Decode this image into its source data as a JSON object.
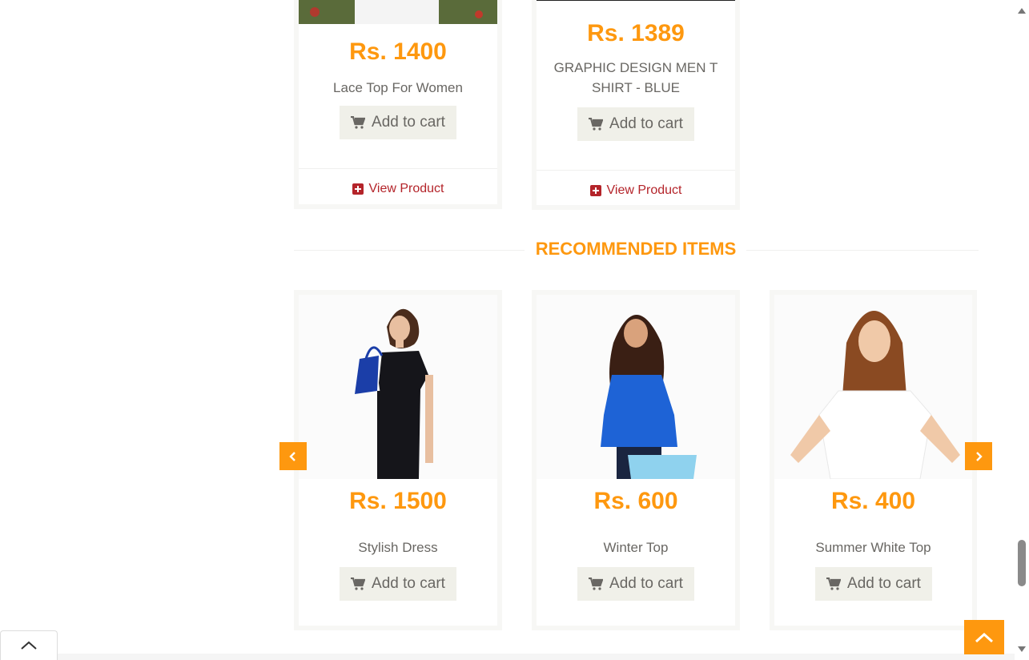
{
  "top_products": [
    {
      "price": "Rs. 1400",
      "name": "Lace Top For Women",
      "add_label": "Add to cart",
      "view_label": "View Product"
    },
    {
      "price": "Rs. 1389",
      "name": "GRAPHIC DESIGN MEN T SHIRT - BLUE",
      "add_label": "Add to cart",
      "view_label": "View Product"
    }
  ],
  "recommended": {
    "title": "RECOMMENDED ITEMS",
    "items": [
      {
        "price": "Rs. 1500",
        "name": "Stylish Dress",
        "add_label": "Add to cart"
      },
      {
        "price": "Rs. 600",
        "name": "Winter Top",
        "add_label": "Add to cart"
      },
      {
        "price": "Rs. 400",
        "name": "Summer White Top",
        "add_label": "Add to cart"
      }
    ]
  },
  "icons": {
    "cart": "shopping-cart-icon",
    "view": "plus-square-icon",
    "prev": "chevron-left-icon",
    "next": "chevron-right-icon",
    "scroll_top": "chevron-up-icon"
  },
  "colors": {
    "accent": "#FE980F",
    "view_link": "#B4242A",
    "button_bg": "#F0F0E9",
    "text": "#696763"
  }
}
